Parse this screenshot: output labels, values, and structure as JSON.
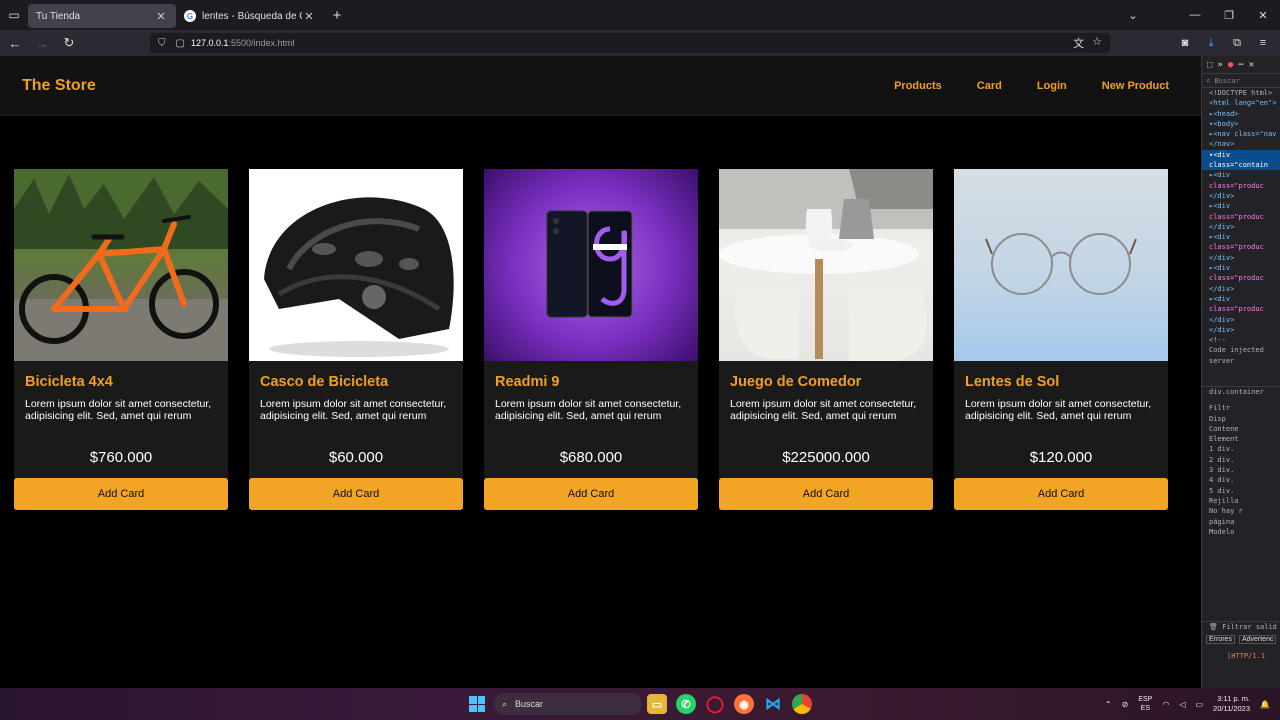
{
  "browser": {
    "tabs": [
      {
        "title": "Tu Tienda",
        "active": true
      },
      {
        "title": "lentes - Búsqueda de Google",
        "active": false
      }
    ],
    "new_tab": "+",
    "url_host": "127.0.0.1",
    "url_path": ":5500/index.html"
  },
  "site": {
    "brand": "The Store",
    "nav": [
      "Products",
      "Card",
      "Login",
      "New Product"
    ]
  },
  "products": [
    {
      "title": "Bicicleta 4x4",
      "description": "Lorem ipsum dolor sit amet consectetur, adipisicing elit. Sed, amet qui rerum",
      "price": "$760.000",
      "button": "Add Card",
      "image": "bicycle"
    },
    {
      "title": "Casco de Bicicleta",
      "description": "Lorem ipsum dolor sit amet consectetur, adipisicing elit. Sed, amet qui rerum",
      "price": "$60.000",
      "button": "Add Card",
      "image": "helmet"
    },
    {
      "title": "Readmi 9",
      "description": "Lorem ipsum dolor sit amet consectetur, adipisicing elit. Sed, amet qui rerum",
      "price": "$680.000",
      "button": "Add Card",
      "image": "phone"
    },
    {
      "title": "Juego de Comedor",
      "description": "Lorem ipsum dolor sit amet consectetur, adipisicing elit. Sed, amet qui rerum",
      "price": "$225000.000",
      "button": "Add Card",
      "image": "dining-set"
    },
    {
      "title": "Lentes de Sol",
      "description": "Lorem ipsum dolor sit amet consectetur, adipisicing elit. Sed, amet qui rerum",
      "price": "$120.000",
      "button": "Add Card",
      "image": "glasses"
    }
  ],
  "devtools": {
    "search_placeholder": "Buscar",
    "filter_label": "Filtr",
    "panel_label": "Disp",
    "container_label": "Contene",
    "grid_label": "Rejilla",
    "model_label": "Modelo",
    "filter_output": "Filtrar salid",
    "breadcrumb": "div.container",
    "errors_tab": "Errores",
    "warnings_tab": "Advertenc",
    "http_line": "[HTTP/1.1 ",
    "no_grid": "No hay r",
    "no_grid2": "página",
    "elements_label": "Element",
    "html_lines": [
      "<!DOCTYPE html>",
      "<html lang=\"en\">",
      "▸<head>",
      "▾<body>",
      "▸<nav class=\"nav",
      "</nav>",
      "▾<div",
      "class=\"contain",
      "▸<div",
      "class=\"produc",
      "</div>",
      "▸<div",
      "class=\"produc",
      "</div>",
      "▸<div",
      "class=\"produc",
      "</div>",
      "▸<div",
      "class=\"produc",
      "</div>",
      "▸<div",
      "class=\"produc",
      "</div>",
      "</div>",
      "<!--",
      "Code injected",
      "server"
    ],
    "flex_items": [
      "1 div.",
      "2 div.",
      "3 div.",
      "4 div.",
      "5 div."
    ]
  },
  "taskbar": {
    "search": "Buscar",
    "lang_top": "ESP",
    "lang_bottom": "ES",
    "time": "3:11 p. m.",
    "date": "20/11/2023"
  }
}
